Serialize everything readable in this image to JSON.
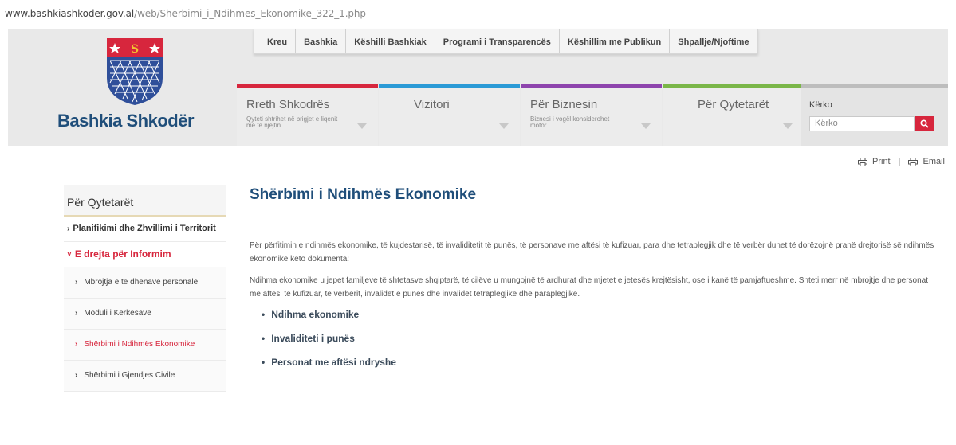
{
  "browser": {
    "url_host": "www.bashkiashkoder.gov.al",
    "url_path": "/web/Sherbimi_i_Ndihmes_Ekonomike_322_1.php"
  },
  "header": {
    "brand": "Bashkia Shkodër",
    "crest_letter": "S",
    "top_menu": [
      "Kreu",
      "Bashkia",
      "Këshilli Bashkiak",
      "Programi i Transparencës",
      "Këshillim me Publikun",
      "Shpallje/Njoftime"
    ],
    "tabs": [
      {
        "title": "Rreth Shkodrës",
        "sub": "Qyteti shtrihet në brigjet e liqenit me të njëjtin",
        "color": "#d7263d"
      },
      {
        "title": "Vizitori",
        "sub": "",
        "color": "#2b9ad6"
      },
      {
        "title": "Për Biznesin",
        "sub": "Biznesi i vogël konsiderohet motor i",
        "color": "#8e44ad"
      },
      {
        "title": "Për Qytetarët",
        "sub": "",
        "color": "#7ab648"
      }
    ],
    "search": {
      "label": "Kërko",
      "placeholder": "Kërko"
    }
  },
  "utility": {
    "print": "Print",
    "email": "Email"
  },
  "sidebar": {
    "heading": "Për Qytetarët",
    "items": [
      {
        "label": "Planifikimi dhe Zhvillimi i Territorit"
      },
      {
        "label": "E drejta për Informim"
      }
    ],
    "subitems": [
      {
        "label": "Mbrojtja e të dhënave personale"
      },
      {
        "label": "Moduli i Kërkesave"
      },
      {
        "label": "Shërbimi i Ndihmës Ekonomike"
      },
      {
        "label": "Shërbimi i Gjendjes Civile"
      }
    ]
  },
  "main": {
    "title": "Shërbimi i Ndihmës Ekonomike",
    "paragraph1": "Për përfitimin e ndihmës ekonomike, të kujdestarisë, të invaliditetit të punës, të personave me aftësi të kufizuar, para dhe tetraplegjik dhe të verbër duhet të dorëzojnë pranë drejtorisë së ndihmës ekonomike këto dokumenta:",
    "paragraph2": "Ndihma ekonomike u jepet familjeve të shtetasve shqiptarë, të cilëve u mungojnë të ardhurat dhe mjetet e jetesës krejtësisht, ose i kanë të pamjaftueshme. Shteti merr në mbrojtje dhe personat me aftësi të kufizuar, të verbërit, invalidët e punës dhe invalidët tetraplegjikë dhe paraplegjikë.",
    "links": [
      "Ndihma ekonomike",
      "Invaliditeti i punës",
      "Personat me aftësi ndryshe"
    ]
  }
}
